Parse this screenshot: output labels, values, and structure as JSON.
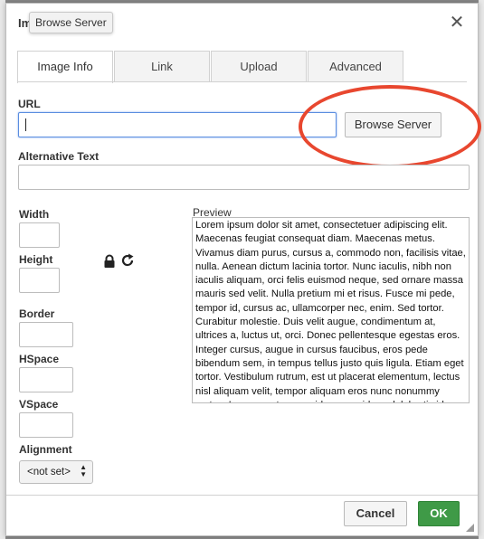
{
  "dialog": {
    "title_partial": "Im",
    "tooltip": "Browse Server",
    "close_symbol": "✕"
  },
  "tabs": [
    {
      "label": "Image Info",
      "active": true
    },
    {
      "label": "Link",
      "active": false
    },
    {
      "label": "Upload",
      "active": false
    },
    {
      "label": "Advanced",
      "active": false
    }
  ],
  "image_info": {
    "url_label": "URL",
    "url_value": "",
    "browse_button": "Browse Server",
    "alt_label": "Alternative Text",
    "alt_value": "",
    "width_label": "Width",
    "height_label": "Height",
    "border_label": "Border",
    "hspace_label": "HSpace",
    "vspace_label": "VSpace",
    "alignment_label": "Alignment",
    "alignment_value": "<not set>",
    "preview_label": "Preview",
    "preview_text": "Lorem ipsum dolor sit amet, consectetuer adipiscing elit. Maecenas feugiat consequat diam. Maecenas metus. Vivamus diam purus, cursus a, commodo non, facilisis vitae, nulla. Aenean dictum lacinia tortor. Nunc iaculis, nibh non iaculis aliquam, orci felis euismod neque, sed ornare massa mauris sed velit. Nulla pretium mi et risus. Fusce mi pede, tempor id, cursus ac, ullamcorper nec, enim. Sed tortor. Curabitur molestie. Duis velit augue, condimentum at, ultrices a, luctus ut, orci. Donec pellentesque egestas eros. Integer cursus, augue in cursus faucibus, eros pede bibendum sem, in tempus tellus justo quis ligula. Etiam eget tortor. Vestibulum rutrum, est ut placerat elementum, lectus nisl aliquam velit, tempor aliquam eros nunc nonummy metus. In eros metus, gravida a, gravida sed, lobortis id, turpis. Ut"
  },
  "footer": {
    "cancel": "Cancel",
    "ok": "OK"
  },
  "icons": {
    "lock": "lock-icon",
    "reset_size": "reset-icon",
    "close": "close-icon"
  },
  "colors": {
    "ok_green": "#3f9a47",
    "focus_blue": "#5a8de0",
    "annotation_red": "#e8472f"
  }
}
